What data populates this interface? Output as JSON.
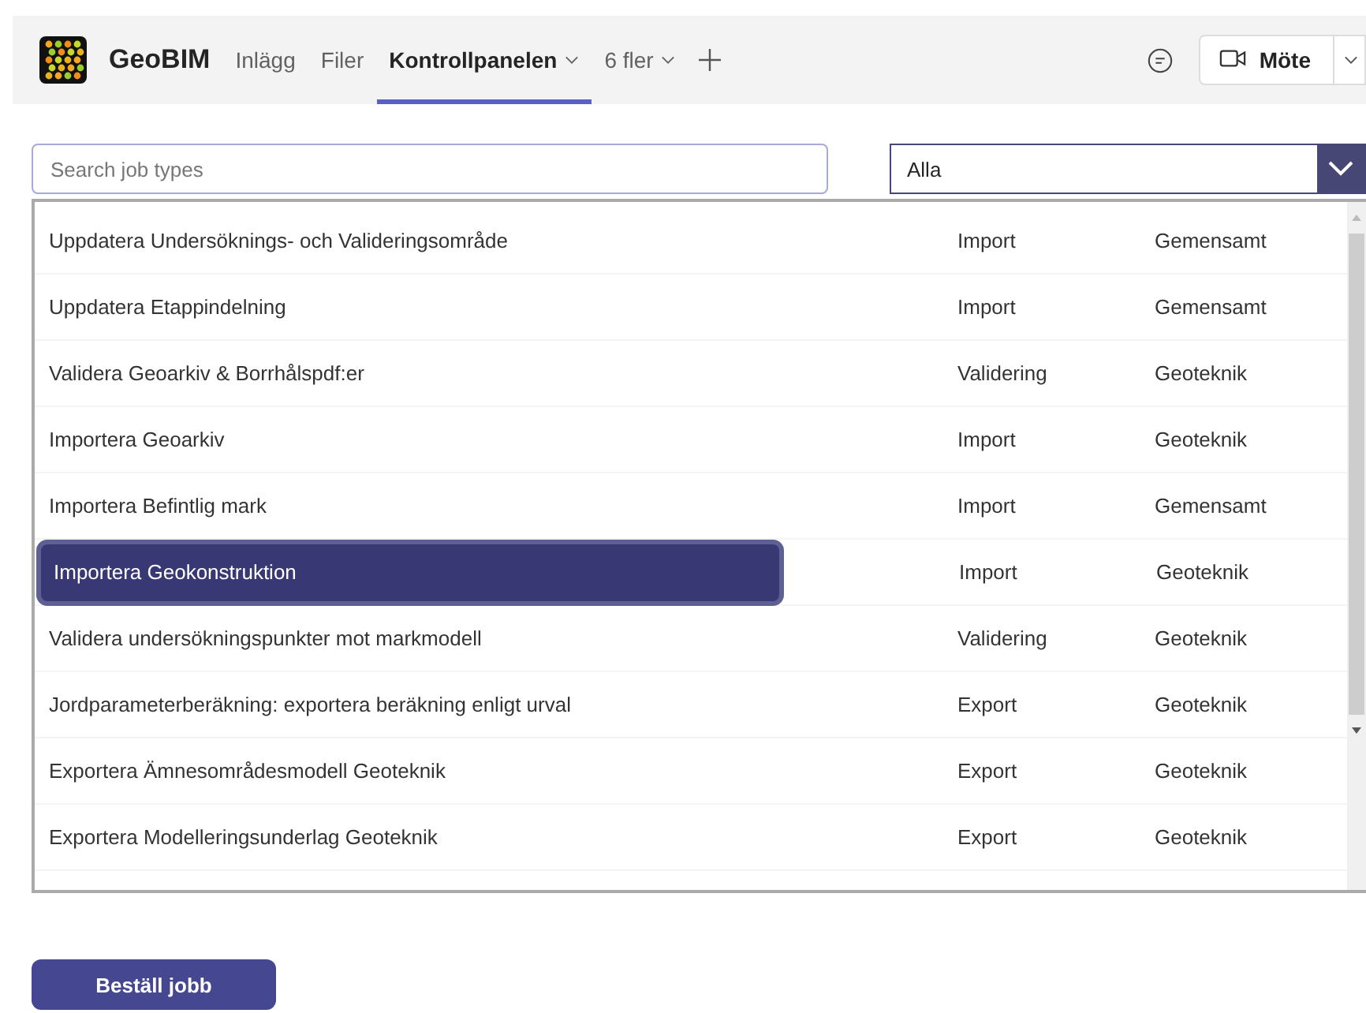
{
  "app": {
    "name": "GeoBIM"
  },
  "tabs": [
    {
      "label": "Inlägg",
      "selected": false,
      "dropdown": false
    },
    {
      "label": "Filer",
      "selected": false,
      "dropdown": false
    },
    {
      "label": "Kontrollpanelen",
      "selected": true,
      "dropdown": true
    },
    {
      "label": "6 fler",
      "selected": false,
      "dropdown": true
    }
  ],
  "meeting_button": {
    "label": "Möte"
  },
  "search": {
    "placeholder": "Search job types"
  },
  "filter": {
    "value": "Alla"
  },
  "job_types": [
    {
      "name": "Uppdatera Undersöknings- och Valideringsområde",
      "type": "Import",
      "category": "Gemensamt",
      "selected": false
    },
    {
      "name": "Uppdatera Etappindelning",
      "type": "Import",
      "category": "Gemensamt",
      "selected": false
    },
    {
      "name": "Validera Geoarkiv & Borrhålspdf:er",
      "type": "Validering",
      "category": "Geoteknik",
      "selected": false
    },
    {
      "name": "Importera Geoarkiv",
      "type": "Import",
      "category": "Geoteknik",
      "selected": false
    },
    {
      "name": "Importera Befintlig mark",
      "type": "Import",
      "category": "Gemensamt",
      "selected": false
    },
    {
      "name": "Importera Geokonstruktion",
      "type": "Import",
      "category": "Geoteknik",
      "selected": true
    },
    {
      "name": "Validera undersökningspunkter mot markmodell",
      "type": "Validering",
      "category": "Geoteknik",
      "selected": false
    },
    {
      "name": "Jordparameterberäkning: exportera beräkning enligt urval",
      "type": "Export",
      "category": "Geoteknik",
      "selected": false
    },
    {
      "name": "Exportera Ämnesområdesmodell Geoteknik",
      "type": "Export",
      "category": "Geoteknik",
      "selected": false
    },
    {
      "name": "Exportera Modelleringsunderlag Geoteknik",
      "type": "Export",
      "category": "Geoteknik",
      "selected": false
    }
  ],
  "order_button": {
    "label": "Beställ jobb"
  }
}
